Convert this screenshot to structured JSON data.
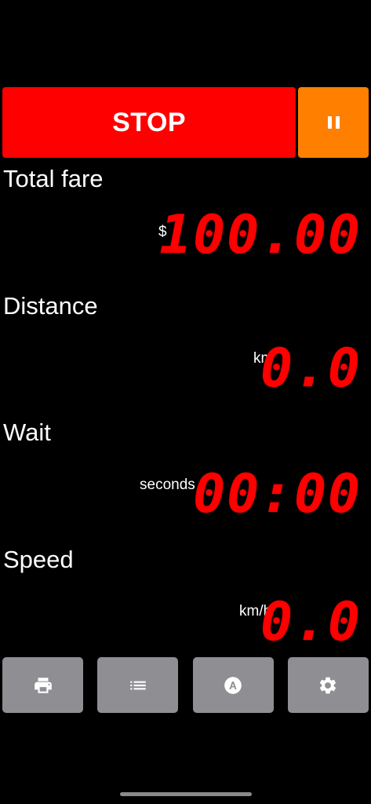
{
  "controls": {
    "stop_label": "STOP",
    "pause_icon": "pause-icon"
  },
  "fare": {
    "label": "Total fare",
    "unit": "$",
    "value": "100.00"
  },
  "distance": {
    "label": "Distance",
    "unit": "km",
    "value": "0.0"
  },
  "wait": {
    "label": "Wait",
    "unit": "seconds",
    "value": "00:00"
  },
  "speed": {
    "label": "Speed",
    "unit": "km/h",
    "value": "0.0"
  },
  "toolbar": {
    "icons": [
      "printer-icon",
      "list-icon",
      "account-circle-icon",
      "gear-icon"
    ]
  },
  "colors": {
    "stop": "#ff0000",
    "pause": "#ff7f00",
    "digits": "#ff0000",
    "tool_button": "#8e8e93",
    "background": "#000000"
  }
}
